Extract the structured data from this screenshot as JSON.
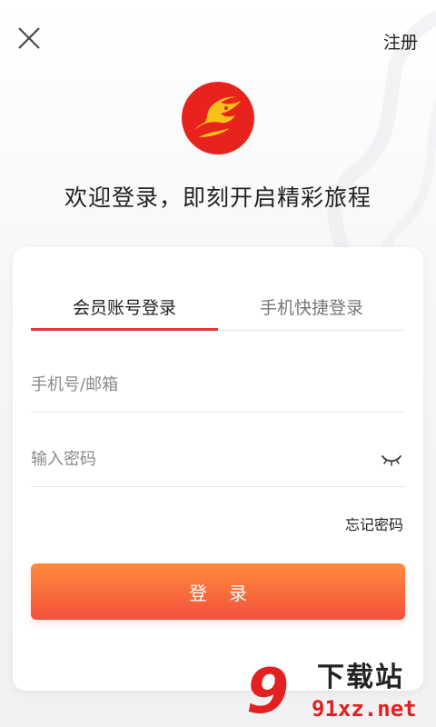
{
  "header": {
    "close_icon": "close-icon",
    "register_label": "注册"
  },
  "brand": {
    "logo_icon": "dragon-logo-icon",
    "logo_color": "#e8231d"
  },
  "welcome_text": "欢迎登录，即刻开启精彩旅程",
  "login_card": {
    "tabs": [
      {
        "label": "会员账号登录",
        "active": true
      },
      {
        "label": "手机快捷登录",
        "active": false
      }
    ],
    "phone_field": {
      "placeholder": "手机号/邮箱",
      "value": ""
    },
    "password_field": {
      "placeholder": "输入密码",
      "value": "",
      "toggle_icon": "eye-closed-icon"
    },
    "forgot_label": "忘记密码",
    "login_label": "登录",
    "accent_color": "#e8333a",
    "button_gradient": [
      "#ff8a3d",
      "#f3513c"
    ]
  },
  "watermark": {
    "mark": "9",
    "top_text": "下载站",
    "bottom_text": "91xz.net"
  }
}
